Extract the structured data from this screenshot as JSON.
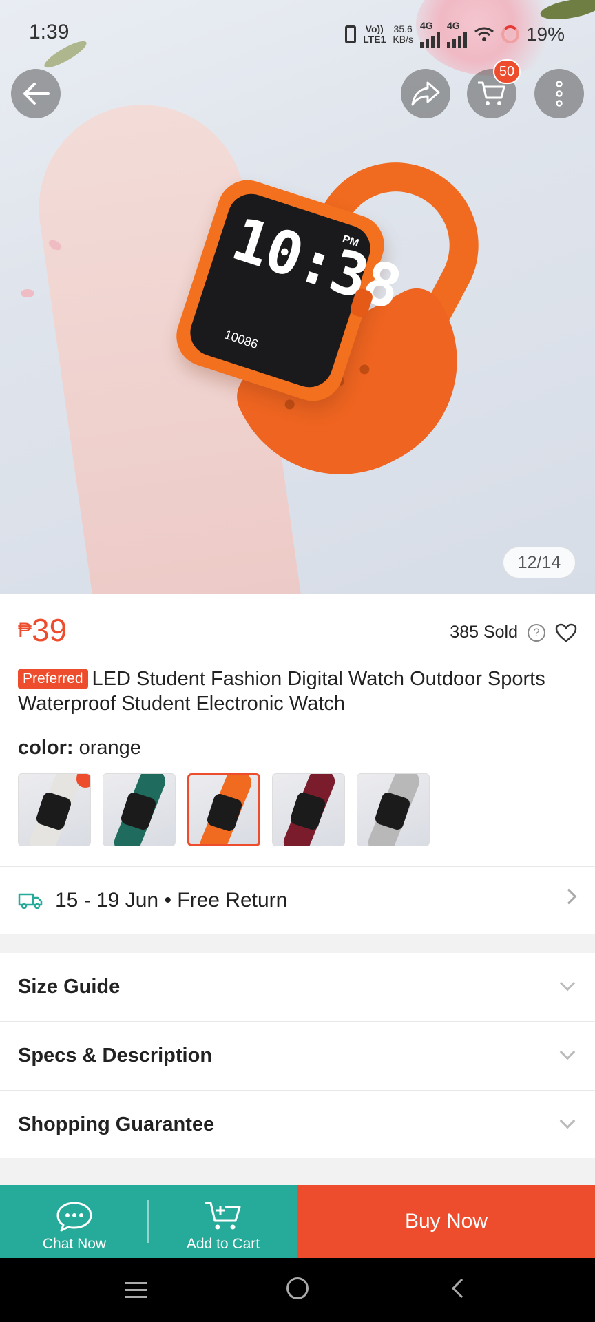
{
  "status_bar": {
    "time": "1:39",
    "volte": "Vo))",
    "lte": "LTE1",
    "speed": "35.6",
    "speed_unit": "KB/s",
    "net1": "4G",
    "net2": "4G",
    "battery": "19%"
  },
  "header": {
    "back_icon": "arrow-left-icon",
    "share_icon": "share-icon",
    "cart_icon": "cart-icon",
    "cart_count": "50",
    "more_icon": "more-vertical-icon"
  },
  "gallery": {
    "counter": "12/14",
    "watch_time": "10:38",
    "watch_pm": "PM",
    "watch_steps": "10086"
  },
  "product": {
    "currency": "₱",
    "price": "39",
    "sold": "385 Sold",
    "preferred_badge": "Preferred",
    "title": "LED Student Fashion Digital Watch Outdoor Sports Waterproof Student Electronic Watch"
  },
  "variation": {
    "label": "color:",
    "selected": "orange",
    "swatches": [
      {
        "name": "white",
        "band": "#e6e4e1"
      },
      {
        "name": "green",
        "band": "#1f6b5e"
      },
      {
        "name": "orange",
        "band": "#f06a1f"
      },
      {
        "name": "wine",
        "band": "#7a1c2c"
      },
      {
        "name": "grey",
        "band": "#b8b8b8"
      }
    ]
  },
  "delivery": {
    "text": "15 - 19 Jun • Free Return"
  },
  "sections": {
    "size_guide": "Size Guide",
    "specs": "Specs & Description",
    "guarantee": "Shopping Guarantee"
  },
  "bottom_bar": {
    "chat": "Chat Now",
    "add_to_cart": "Add to Cart",
    "buy_now": "Buy Now"
  },
  "colors": {
    "accent": "#ee4d2d",
    "teal": "#26aa99"
  }
}
